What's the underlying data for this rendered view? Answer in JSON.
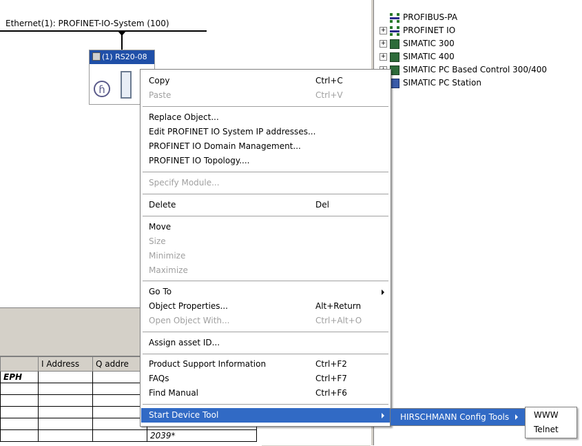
{
  "network": {
    "bus_label": "Ethernet(1): PROFINET-IO-System (100)",
    "device_title": "(1) RS20-08",
    "device_logo_glyph": "ɦ"
  },
  "catalog": {
    "items": [
      {
        "label": "PROFIBUS-PA",
        "icon": "bus-icon",
        "expander": ""
      },
      {
        "label": "PROFINET IO",
        "icon": "bus-icon",
        "expander": "+"
      },
      {
        "label": "SIMATIC 300",
        "icon": "rack-icon",
        "expander": "+"
      },
      {
        "label": "SIMATIC 400",
        "icon": "rack-icon",
        "expander": "+"
      },
      {
        "label": "SIMATIC PC Based Control 300/400",
        "icon": "rack-icon",
        "expander": "+"
      },
      {
        "label": "SIMATIC PC Station",
        "icon": "pc-icon",
        "expander": ""
      }
    ]
  },
  "table": {
    "headers": [
      "",
      "I Address",
      "Q addre"
    ],
    "first_row_label": "EPH",
    "row_value": "2039*"
  },
  "context_menu": {
    "copy": {
      "label": "Copy",
      "shortcut": "Ctrl+C"
    },
    "paste": {
      "label": "Paste",
      "shortcut": "Ctrl+V"
    },
    "replace_object": "Replace Object...",
    "edit_ip": "Edit PROFINET IO System IP addresses...",
    "domain_mgmt": "PROFINET IO Domain Management...",
    "topology": "PROFINET IO Topology....",
    "specify_module": "Specify Module...",
    "delete": {
      "label": "Delete",
      "shortcut": "Del"
    },
    "move": "Move",
    "size": "Size",
    "minimize": "Minimize",
    "maximize": "Maximize",
    "go_to": "Go To",
    "object_properties": {
      "label": "Object Properties...",
      "shortcut": "Alt+Return"
    },
    "open_object_with": {
      "label": "Open Object With...",
      "shortcut": "Ctrl+Alt+O"
    },
    "assign_asset": "Assign asset ID...",
    "product_support": {
      "label": "Product Support Information",
      "shortcut": "Ctrl+F2"
    },
    "faqs": {
      "label": "FAQs",
      "shortcut": "Ctrl+F7"
    },
    "find_manual": {
      "label": "Find Manual",
      "shortcut": "Ctrl+F6"
    },
    "start_device_tool": "Start Device Tool"
  },
  "submenu": {
    "hirschmann": "HIRSCHMANN Config Tools",
    "www": "WWW",
    "telnet": "Telnet"
  },
  "colors": {
    "highlight": "#316ac5",
    "disabled_text": "#a0a0a0",
    "title_bar": "#1f4fa8"
  }
}
